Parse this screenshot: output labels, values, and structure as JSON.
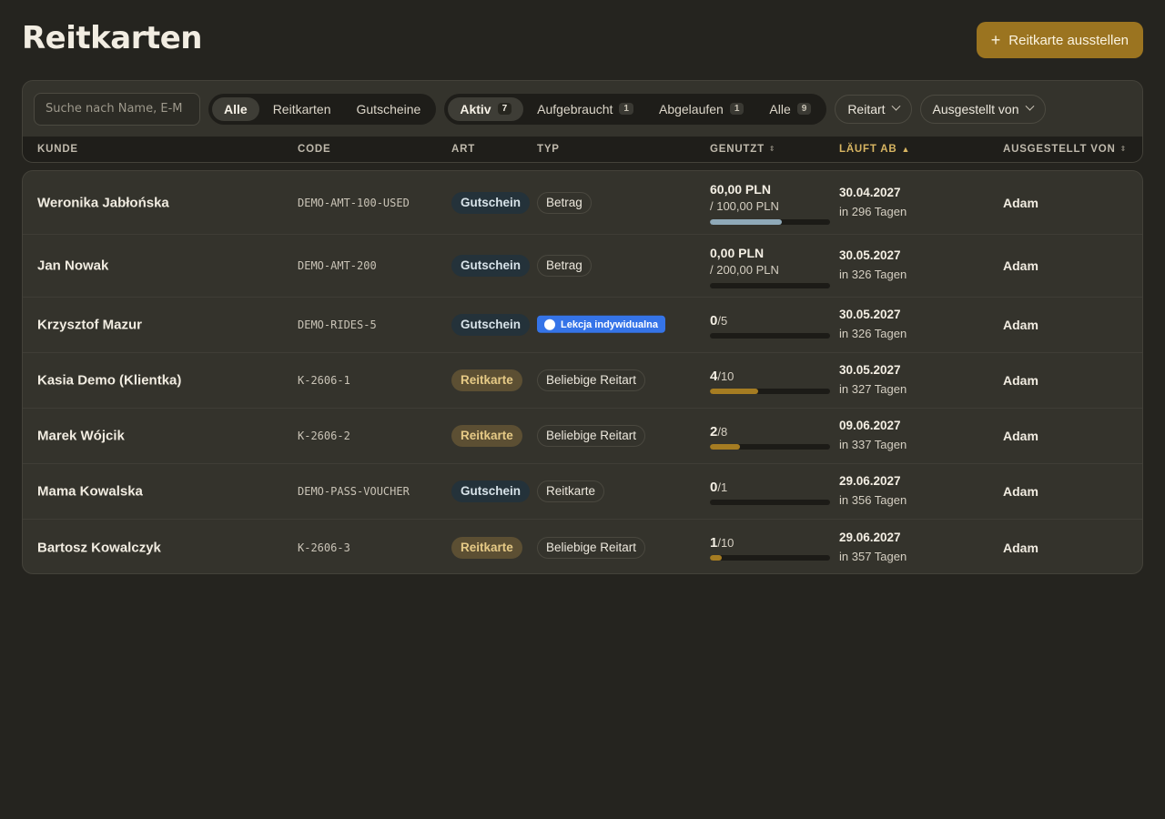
{
  "page": {
    "title": "Reitkarten",
    "new_button": "Reitkarte ausstellen"
  },
  "toolbar": {
    "search_placeholder": "Suche nach Name, E-M",
    "kind_filters": [
      {
        "label": "Alle",
        "active": true
      },
      {
        "label": "Reitkarten",
        "active": false
      },
      {
        "label": "Gutscheine",
        "active": false
      }
    ],
    "status_filters": [
      {
        "label": "Aktiv",
        "count": "7",
        "active": true
      },
      {
        "label": "Aufgebraucht",
        "count": "1",
        "active": false
      },
      {
        "label": "Abgelaufen",
        "count": "1",
        "active": false
      },
      {
        "label": "Alle",
        "count": "9",
        "active": false
      }
    ],
    "ride_type_dropdown": "Reitart",
    "issuer_dropdown": "Ausgestellt von"
  },
  "table": {
    "headers": {
      "customer": "KUNDE",
      "code": "CODE",
      "art": "ART",
      "typ": "TYP",
      "used": "GENUTZT",
      "expires": "LÄUFT AB",
      "issuer": "AUSGESTELLT VON"
    },
    "colors": {
      "voucher_bar": "#8fa9b8",
      "pass_bar": "#a57c22"
    },
    "rows": [
      {
        "customer": "Weronika Jabłońska",
        "code": "DEMO-AMT-100-USED",
        "art": "Gutschein",
        "art_kind": "voucher",
        "typ": "Betrag",
        "typ_kind": "chip",
        "used_mode": "amount",
        "used_main": "60,00 PLN",
        "used_sub": "/ 100,00 PLN",
        "progress": 0.6,
        "expires_date": "30.04.2027",
        "expires_rel": "in 296 Tagen",
        "issuer": "Adam"
      },
      {
        "customer": "Jan Nowak",
        "code": "DEMO-AMT-200",
        "art": "Gutschein",
        "art_kind": "voucher",
        "typ": "Betrag",
        "typ_kind": "chip",
        "used_mode": "amount",
        "used_main": "0,00 PLN",
        "used_sub": "/ 200,00 PLN",
        "progress": 0,
        "expires_date": "30.05.2027",
        "expires_rel": "in 326 Tagen",
        "issuer": "Adam"
      },
      {
        "customer": "Krzysztof Mazur",
        "code": "DEMO-RIDES-5",
        "art": "Gutschein",
        "art_kind": "voucher",
        "typ": "Lekcja indywidualna",
        "typ_kind": "lesson",
        "used_mode": "count",
        "used_main": "0",
        "used_sub": "/5",
        "progress": 0,
        "expires_date": "30.05.2027",
        "expires_rel": "in 326 Tagen",
        "issuer": "Adam"
      },
      {
        "customer": "Kasia Demo (Klientka)",
        "code": "K-2606-1",
        "art": "Reitkarte",
        "art_kind": "pass",
        "typ": "Beliebige Reitart",
        "typ_kind": "chip",
        "used_mode": "count",
        "used_main": "4",
        "used_sub": "/10",
        "progress": 0.4,
        "expires_date": "30.05.2027",
        "expires_rel": "in 327 Tagen",
        "issuer": "Adam"
      },
      {
        "customer": "Marek Wójcik",
        "code": "K-2606-2",
        "art": "Reitkarte",
        "art_kind": "pass",
        "typ": "Beliebige Reitart",
        "typ_kind": "chip",
        "used_mode": "count",
        "used_main": "2",
        "used_sub": "/8",
        "progress": 0.25,
        "expires_date": "09.06.2027",
        "expires_rel": "in 337 Tagen",
        "issuer": "Adam"
      },
      {
        "customer": "Mama Kowalska",
        "code": "DEMO-PASS-VOUCHER",
        "art": "Gutschein",
        "art_kind": "voucher",
        "typ": "Reitkarte",
        "typ_kind": "chip",
        "used_mode": "count",
        "used_main": "0",
        "used_sub": "/1",
        "progress": 0,
        "expires_date": "29.06.2027",
        "expires_rel": "in 356 Tagen",
        "issuer": "Adam"
      },
      {
        "customer": "Bartosz Kowalczyk",
        "code": "K-2606-3",
        "art": "Reitkarte",
        "art_kind": "pass",
        "typ": "Beliebige Reitart",
        "typ_kind": "chip",
        "used_mode": "count",
        "used_main": "1",
        "used_sub": "/10",
        "progress": 0.1,
        "expires_date": "29.06.2027",
        "expires_rel": "in 357 Tagen",
        "issuer": "Adam"
      }
    ]
  }
}
